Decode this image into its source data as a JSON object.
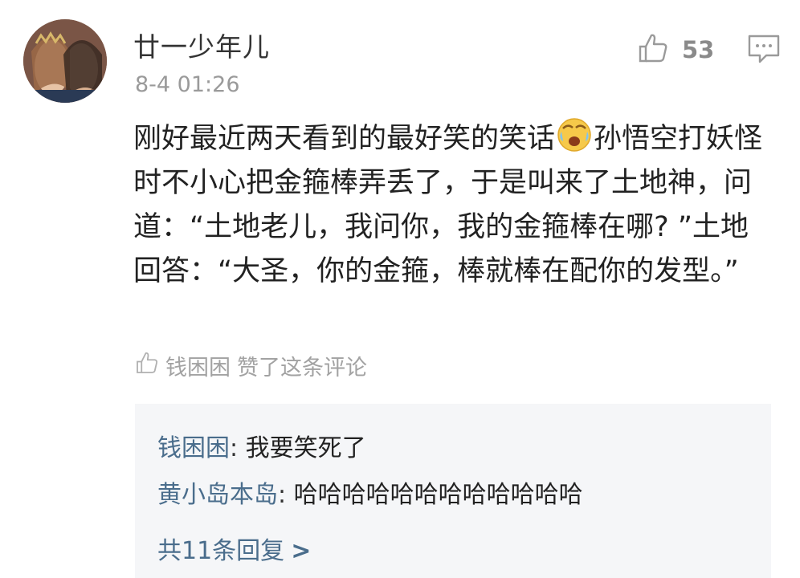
{
  "comment": {
    "username": "廿一少年儿",
    "timestamp": "8-4 01:26",
    "like_count": "53",
    "text_part1": "刚好最近两天看到的最好笑的笑话",
    "text_part2": "孙悟空打妖怪时不小心把金箍棒弄丢了，于是叫来了土地神，问道：“土地老儿，我问你，我的金箍棒在哪? ”土地回答：“大圣，你的金箍，棒就棒在配你的发型。”",
    "emoji": "crying-laughing-emoji"
  },
  "liked_by": {
    "name": "钱困困",
    "action": "赞了这条评论"
  },
  "replies": [
    {
      "name": "钱困困",
      "sep": ": ",
      "content": "我要笑死了"
    },
    {
      "name": "黄小岛本岛",
      "sep": ": ",
      "content": "哈哈哈哈哈哈哈哈哈哈哈哈"
    }
  ],
  "more_replies": {
    "label": "共11条回复",
    "arrow": ">"
  },
  "icons": {
    "like": "thumbs-up-icon",
    "reply": "comment-icon",
    "liked_by": "thumbs-up-small-icon"
  },
  "colors": {
    "link": "#4a6d8c",
    "muted": "#9a9a9a",
    "reply_bg": "#f5f6f8"
  }
}
